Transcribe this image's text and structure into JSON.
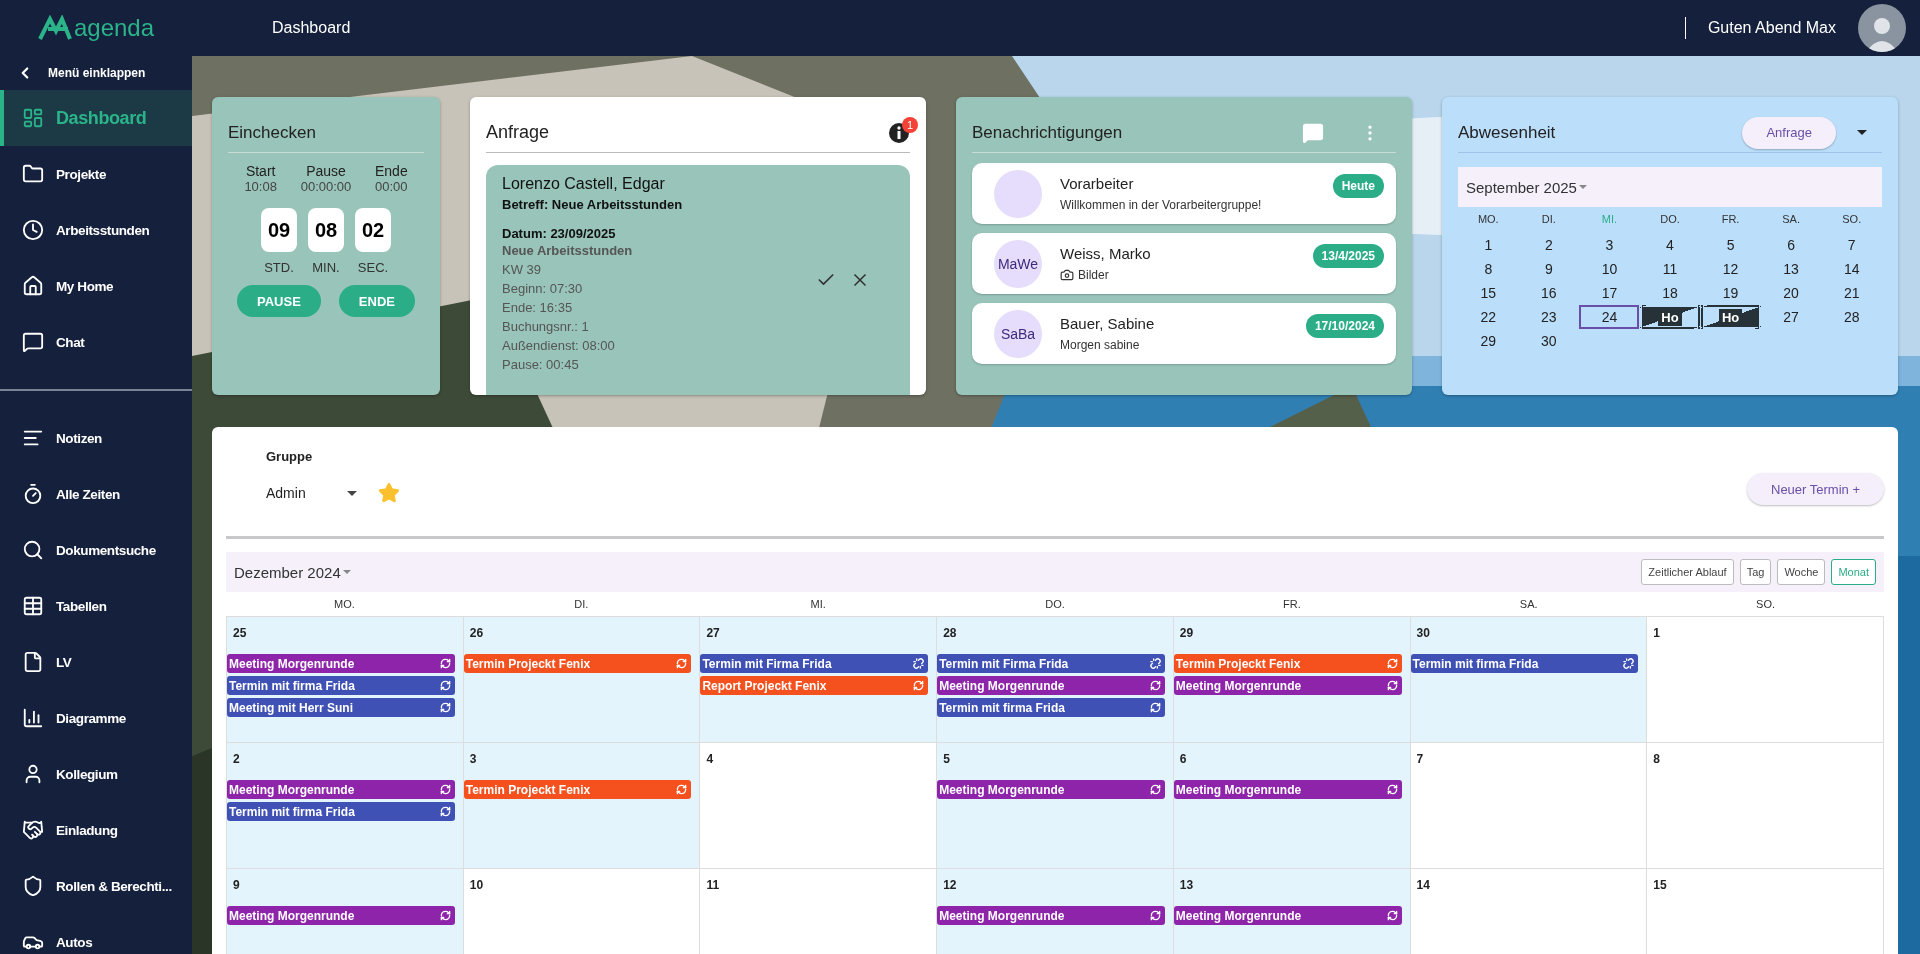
{
  "header": {
    "logo": "agenda",
    "title": "Dashboard",
    "greeting": "Guten Abend Max"
  },
  "sidebar": {
    "collapse": "Menü einklappen",
    "items": [
      {
        "label": "Dashboard",
        "selected": true
      },
      {
        "label": "Projekte",
        "selected": false
      },
      {
        "label": "Arbeitsstunden",
        "selected": false
      },
      {
        "label": "My Home",
        "selected": false
      },
      {
        "label": "Chat",
        "selected": false
      }
    ],
    "more_items": [
      {
        "label": "Notizen",
        "selected": false
      },
      {
        "label": "Alle Zeiten",
        "selected": false
      },
      {
        "label": "Dokumentsuche",
        "selected": false
      },
      {
        "label": "Tabellen",
        "selected": false
      },
      {
        "label": "LV",
        "selected": false
      },
      {
        "label": "Diagramme",
        "selected": false
      },
      {
        "label": "Kollegium",
        "selected": false
      },
      {
        "label": "Einladung",
        "selected": false
      },
      {
        "label": "Rollen & Berechti...",
        "selected": false
      },
      {
        "label": "Autos",
        "selected": false
      }
    ]
  },
  "checkin": {
    "title": "Einchecken",
    "columns": [
      {
        "label": "Start",
        "value": "10:08"
      },
      {
        "label": "Pause",
        "value": "00:00:00"
      },
      {
        "label": "Ende",
        "value": "00:00"
      }
    ],
    "timer": [
      {
        "value": "09",
        "unit": "STD."
      },
      {
        "value": "08",
        "unit": "MIN."
      },
      {
        "value": "02",
        "unit": "SEC."
      }
    ],
    "buttons": [
      "PAUSE",
      "ENDE"
    ]
  },
  "request": {
    "title": "Anfrage",
    "badge": "1",
    "name": "Lorenzo Castell, Edgar",
    "subject": "Betreff: Neue Arbeitsstunden",
    "date": "Datum: 23/09/2025",
    "type": "Neue Arbeitsstunden",
    "lines": [
      "KW 39",
      "Beginn: 07:30",
      "Ende: 16:35",
      "Buchungsnr.: 1",
      "Außendienst: 08:00",
      "Pause: 00:45"
    ]
  },
  "notifications": {
    "title": "Benachrichtigungen",
    "items": [
      {
        "name": "Vorarbeiter",
        "message": "Willkommen in der Vorarbeitergruppe!",
        "date": "Heute",
        "attachment": false
      },
      {
        "initials": "MaWe",
        "name": "Weiss, Marko",
        "message": "Bilder",
        "date": "13/4/2025",
        "attachment": true
      },
      {
        "initials": "SaBa",
        "name": "Bauer, Sabine",
        "message": "Morgen sabine",
        "date": "17/10/2024",
        "attachment": false
      }
    ]
  },
  "absence": {
    "title": "Abwesenheit",
    "button": "Anfrage",
    "month": "September 2025",
    "weekdays": [
      {
        "label": "MO.",
        "today": false
      },
      {
        "label": "DI.",
        "today": false
      },
      {
        "label": "MI.",
        "today": true
      },
      {
        "label": "DO.",
        "today": false
      },
      {
        "label": "FR.",
        "today": false
      },
      {
        "label": "SA.",
        "today": false
      },
      {
        "label": "SO.",
        "today": false
      }
    ],
    "days": [
      {
        "label": "1",
        "kind": "day",
        "selected": false
      },
      {
        "label": "2",
        "kind": "day",
        "selected": false
      },
      {
        "label": "3",
        "kind": "day",
        "selected": false
      },
      {
        "label": "4",
        "kind": "day",
        "selected": false
      },
      {
        "label": "5",
        "kind": "day",
        "selected": false
      },
      {
        "label": "6",
        "kind": "day",
        "selected": false
      },
      {
        "label": "7",
        "kind": "day",
        "selected": false
      },
      {
        "label": "8",
        "kind": "day",
        "selected": false
      },
      {
        "label": "9",
        "kind": "day",
        "selected": false
      },
      {
        "label": "10",
        "kind": "day",
        "selected": false
      },
      {
        "label": "11",
        "kind": "day",
        "selected": false
      },
      {
        "label": "12",
        "kind": "day",
        "selected": false
      },
      {
        "label": "13",
        "kind": "day",
        "selected": false
      },
      {
        "label": "14",
        "kind": "day",
        "selected": false
      },
      {
        "label": "15",
        "kind": "day",
        "selected": false
      },
      {
        "label": "16",
        "kind": "day",
        "selected": false
      },
      {
        "label": "17",
        "kind": "day",
        "selected": false
      },
      {
        "label": "18",
        "kind": "day",
        "selected": false
      },
      {
        "label": "19",
        "kind": "day",
        "selected": false
      },
      {
        "label": "20",
        "kind": "day",
        "selected": false
      },
      {
        "label": "21",
        "kind": "day",
        "selected": false
      },
      {
        "label": "22",
        "kind": "day",
        "selected": false
      },
      {
        "label": "23",
        "kind": "day",
        "selected": false
      },
      {
        "label": "24",
        "kind": "day",
        "selected": true
      },
      {
        "label": "Ho",
        "kind": "absence_start",
        "selected": false
      },
      {
        "label": "Ho",
        "kind": "absence_end",
        "selected": false
      },
      {
        "label": "27",
        "kind": "day",
        "selected": false
      },
      {
        "label": "28",
        "kind": "day",
        "selected": false
      },
      {
        "label": "29",
        "kind": "day",
        "selected": false
      },
      {
        "label": "30",
        "kind": "day",
        "selected": false
      }
    ]
  },
  "calendar": {
    "group_label": "Gruppe",
    "group": "Admin",
    "favorite": true,
    "new_button": "Neuer Termin +",
    "month": "Dezember 2024",
    "views": [
      {
        "label": "Zeitlicher Ablauf",
        "selected": false
      },
      {
        "label": "Tag",
        "selected": false
      },
      {
        "label": "Woche",
        "selected": false
      },
      {
        "label": "Monat",
        "selected": true
      }
    ],
    "weekdays": [
      "MO.",
      "DI.",
      "MI.",
      "DO.",
      "FR.",
      "SA.",
      "SO."
    ],
    "cells": [
      {
        "day": "25",
        "shaded": true,
        "events": [
          {
            "title": "Meeting Morgenrunde",
            "color": "#8e24aa",
            "kind": "repeat"
          },
          {
            "title": "Termin mit firma Frida",
            "color": "#3f51b5",
            "kind": "repeat"
          },
          {
            "title": "Meeting mit Herr Suni",
            "color": "#3f51b5",
            "kind": "repeat"
          }
        ]
      },
      {
        "day": "26",
        "shaded": true,
        "events": [
          {
            "title": "Termin Projeckt Fenix",
            "color": "#f4511e",
            "kind": "repeat"
          }
        ]
      },
      {
        "day": "27",
        "shaded": true,
        "events": [
          {
            "title": "Termin mit Firma Frida",
            "color": "#3f51b5",
            "kind": "unlinked"
          },
          {
            "title": "Report Projeckt Fenix",
            "color": "#f4511e",
            "kind": "repeat"
          }
        ]
      },
      {
        "day": "28",
        "shaded": true,
        "events": [
          {
            "title": "Termin mit Firma Frida",
            "color": "#3f51b5",
            "kind": "unlinked"
          },
          {
            "title": "Meeting Morgenrunde",
            "color": "#8e24aa",
            "kind": "repeat"
          },
          {
            "title": "Termin mit firma Frida",
            "color": "#3f51b5",
            "kind": "repeat"
          }
        ]
      },
      {
        "day": "29",
        "shaded": true,
        "events": [
          {
            "title": "Termin Projeckt Fenix",
            "color": "#f4511e",
            "kind": "repeat"
          },
          {
            "title": "Meeting Morgenrunde",
            "color": "#8e24aa",
            "kind": "repeat"
          }
        ]
      },
      {
        "day": "30",
        "shaded": true,
        "events": [
          {
            "title": "Termin mit firma Frida",
            "color": "#3f51b5",
            "kind": "unlinked"
          }
        ]
      },
      {
        "day": "1",
        "shaded": false
      },
      {
        "day": "2",
        "shaded": true,
        "events": [
          {
            "title": "Meeting Morgenrunde",
            "color": "#8e24aa",
            "kind": "repeat"
          },
          {
            "title": "Termin mit firma Frida",
            "color": "#3f51b5",
            "kind": "repeat"
          }
        ]
      },
      {
        "day": "3",
        "shaded": true,
        "events": [
          {
            "title": "Termin Projeckt Fenix",
            "color": "#f4511e",
            "kind": "repeat"
          }
        ]
      },
      {
        "day": "4",
        "shaded": false
      },
      {
        "day": "5",
        "shaded": true,
        "events": [
          {
            "title": "Meeting Morgenrunde",
            "color": "#8e24aa",
            "kind": "repeat"
          }
        ]
      },
      {
        "day": "6",
        "shaded": true,
        "events": [
          {
            "title": "Meeting Morgenrunde",
            "color": "#8e24aa",
            "kind": "repeat"
          }
        ]
      },
      {
        "day": "7",
        "shaded": false
      },
      {
        "day": "8",
        "shaded": false
      },
      {
        "day": "9",
        "shaded": true,
        "events": [
          {
            "title": "Meeting Morgenrunde",
            "color": "#8e24aa",
            "kind": "repeat"
          }
        ]
      },
      {
        "day": "10",
        "shaded": false
      },
      {
        "day": "11",
        "shaded": false
      },
      {
        "day": "12",
        "shaded": true,
        "events": [
          {
            "title": "Meeting Morgenrunde",
            "color": "#8e24aa",
            "kind": "repeat"
          }
        ]
      },
      {
        "day": "13",
        "shaded": true,
        "events": [
          {
            "title": "Meeting Morgenrunde",
            "color": "#8e24aa",
            "kind": "repeat"
          }
        ]
      },
      {
        "day": "14",
        "shaded": false
      },
      {
        "day": "15",
        "shaded": false
      }
    ]
  }
}
